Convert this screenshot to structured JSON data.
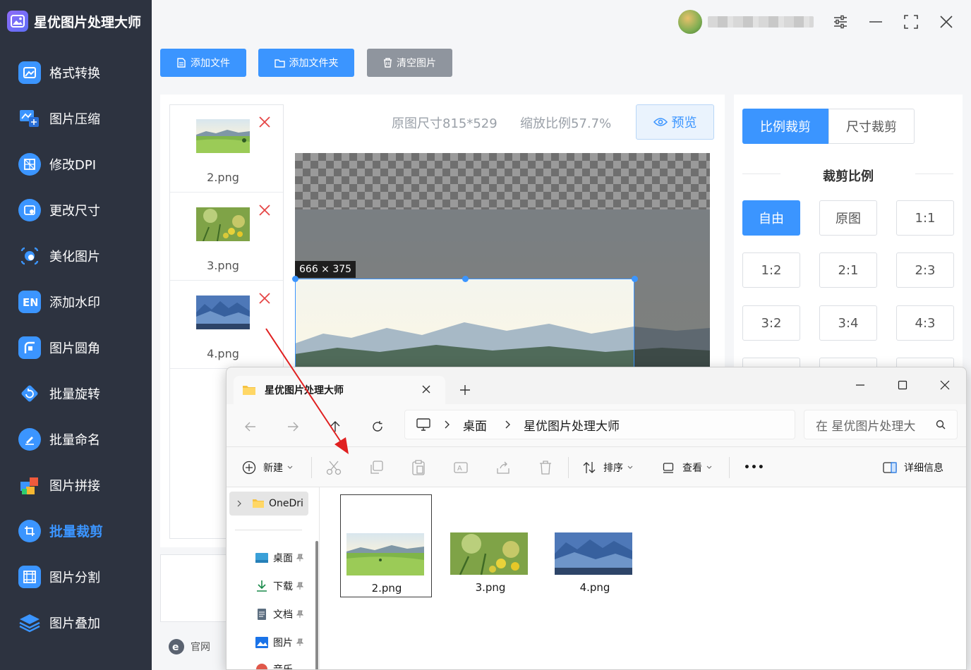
{
  "app": {
    "title": "星优图片处理大师",
    "site_link": "官网"
  },
  "sidebar": {
    "items": [
      {
        "label": "格式转换",
        "icon": "format-convert-icon",
        "color": "#3b95ff"
      },
      {
        "label": "图片压缩",
        "icon": "compress-icon",
        "color": "#3b95ff"
      },
      {
        "label": "修改DPI",
        "icon": "dpi-icon",
        "color": "#3b95ff"
      },
      {
        "label": "更改尺寸",
        "icon": "resize-icon",
        "color": "#3b95ff"
      },
      {
        "label": "美化图片",
        "icon": "beautify-icon",
        "color": "#3b95ff"
      },
      {
        "label": "添加水印",
        "icon": "watermark-icon",
        "color": "#3b95ff"
      },
      {
        "label": "图片圆角",
        "icon": "round-corner-icon",
        "color": "#3b95ff"
      },
      {
        "label": "批量旋转",
        "icon": "rotate-icon",
        "color": "#3b95ff"
      },
      {
        "label": "批量命名",
        "icon": "rename-icon",
        "color": "#3b95ff"
      },
      {
        "label": "图片拼接",
        "icon": "puzzle-icon",
        "color": "#f05a3c"
      },
      {
        "label": "批量裁剪",
        "icon": "crop-icon",
        "color": "#3b95ff"
      },
      {
        "label": "图片分割",
        "icon": "split-icon",
        "color": "#3b95ff"
      },
      {
        "label": "图片叠加",
        "icon": "layers-icon",
        "color": "#3b95ff"
      }
    ],
    "active_index": 10
  },
  "toolbar": {
    "add_file": "添加文件",
    "add_folder": "添加文件夹",
    "clear": "清空图片"
  },
  "files": [
    {
      "name": "2.png"
    },
    {
      "name": "3.png"
    },
    {
      "name": "4.png"
    }
  ],
  "editor": {
    "original_size": "原图尺寸815*529",
    "zoom": "缩放比例57.7%",
    "preview": "预览",
    "crop_size_tag": "666 × 375"
  },
  "crop_panel": {
    "tab_ratio": "比例裁剪",
    "tab_size": "尺寸裁剪",
    "section_title": "裁剪比例",
    "ratios": [
      "自由",
      "原图",
      "1:1",
      "1:2",
      "2:1",
      "2:3",
      "3:2",
      "3:4",
      "4:3"
    ],
    "selected": "自由"
  },
  "explorer": {
    "tab_title": "星优图片处理大师",
    "breadcrumb": [
      "桌面",
      "星优图片处理大师"
    ],
    "search_placeholder": "在 星优图片处理大",
    "commands": {
      "new": "新建",
      "sort": "排序",
      "view": "查看",
      "more": "•••",
      "details": "详细信息"
    },
    "tree": [
      "OneDri",
      "桌面",
      "下载",
      "文档",
      "图片",
      "音乐"
    ],
    "files": [
      "2.png",
      "3.png",
      "4.png"
    ],
    "selected_file": "2.png"
  },
  "colors": {
    "accent": "#3b95ff",
    "sidebar_bg": "#2d3340",
    "clear_button": "#8f959e",
    "delete_x": "#e54545"
  }
}
